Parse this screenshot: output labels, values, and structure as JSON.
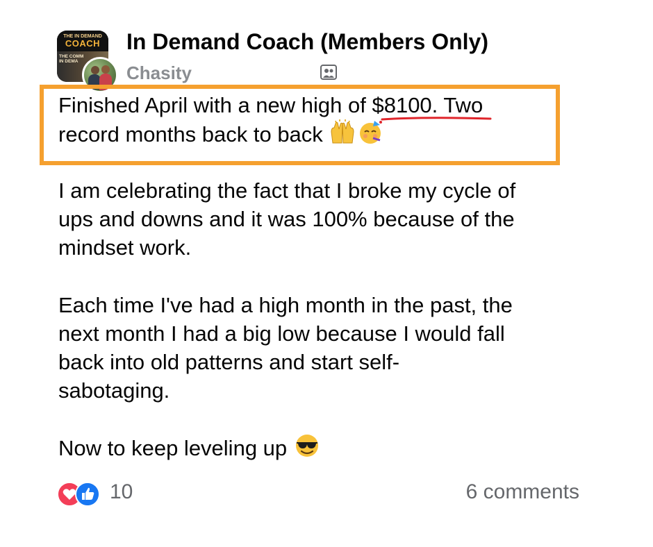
{
  "group": {
    "name": "In Demand Coach (Members Only)",
    "logo_small_text": "THE IN DEMAND",
    "logo_big_text": "COACH",
    "logo_bottom_text": "THE COMM\nIN DEMA"
  },
  "post": {
    "author": "Chasity",
    "paragraphs": [
      "Finished April with a new high of $8100. Two\nrecord months back to back",
      "I am celebrating the fact that I broke my cycle of\nups and downs and it was 100% because of the\nmindset work.",
      "Each time I've had a high month in the past, the\nnext month I had a big low because I would fall\nback into old patterns and start self-\nsabotaging.",
      "Now to keep leveling up"
    ]
  },
  "footer": {
    "reaction_count": "10",
    "comments": "6 comments"
  },
  "colors": {
    "highlight_border": "#f5a02f",
    "underline": "#e0252b",
    "like_blue": "#1877f2",
    "love_red": "#f33e58",
    "secondary_text": "#65676b"
  },
  "icons": [
    "members-icon",
    "raising-hands-icon",
    "partying-face-icon",
    "sunglasses-face-icon",
    "love-reaction-icon",
    "like-reaction-icon"
  ]
}
